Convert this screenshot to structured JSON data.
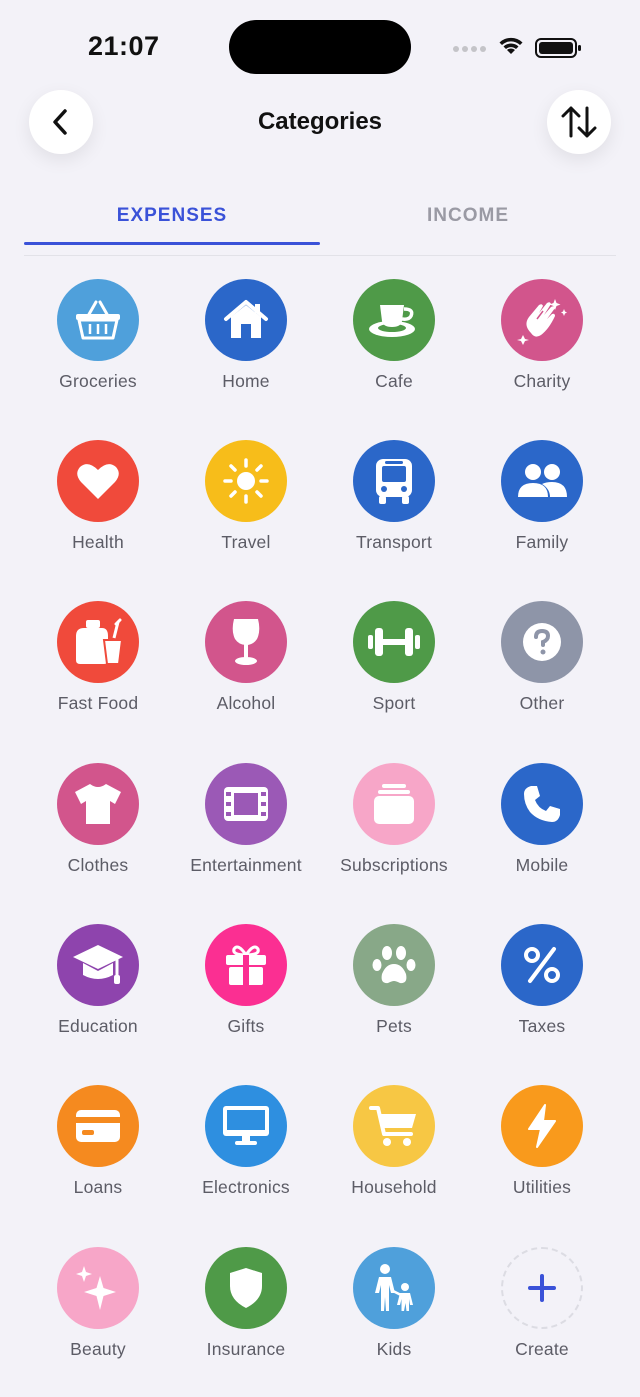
{
  "status_bar": {
    "time": "21:07"
  },
  "header": {
    "title": "Categories",
    "back_icon": "chevron-left-icon",
    "sort_icon": "arrows-up-down-icon"
  },
  "tabs": [
    {
      "label": "EXPENSES",
      "selected": true
    },
    {
      "label": "INCOME",
      "selected": false
    }
  ],
  "colors": {
    "accent": "#3a52d8"
  },
  "categories": [
    {
      "label": "Groceries",
      "icon": "basket-icon",
      "color": "#4fa0db"
    },
    {
      "label": "Home",
      "icon": "house-icon",
      "color": "#2b67c9"
    },
    {
      "label": "Cafe",
      "icon": "coffee-cup-icon",
      "color": "#4f9a48"
    },
    {
      "label": "Charity",
      "icon": "clapping-hands-icon",
      "color": "#d2558c"
    },
    {
      "label": "Health",
      "icon": "heart-icon",
      "color": "#f04a3b"
    },
    {
      "label": "Travel",
      "icon": "sun-icon",
      "color": "#f7bd1a"
    },
    {
      "label": "Transport",
      "icon": "bus-icon",
      "color": "#2b67c9"
    },
    {
      "label": "Family",
      "icon": "people-icon",
      "color": "#2b67c9"
    },
    {
      "label": "Fast Food",
      "icon": "fast-food-icon",
      "color": "#f04a3b"
    },
    {
      "label": "Alcohol",
      "icon": "wine-glass-icon",
      "color": "#d2558c"
    },
    {
      "label": "Sport",
      "icon": "dumbbell-icon",
      "color": "#4f9a48"
    },
    {
      "label": "Other",
      "icon": "question-icon",
      "color": "#8e95a8"
    },
    {
      "label": "Clothes",
      "icon": "tshirt-icon",
      "color": "#d2558c"
    },
    {
      "label": "Entertainment",
      "icon": "film-icon",
      "color": "#9b59b6"
    },
    {
      "label": "Subscriptions",
      "icon": "stack-icon",
      "color": "#f7a6c8"
    },
    {
      "label": "Mobile",
      "icon": "phone-icon",
      "color": "#2b67c9"
    },
    {
      "label": "Education",
      "icon": "graduation-cap-icon",
      "color": "#8e44ad"
    },
    {
      "label": "Gifts",
      "icon": "gift-icon",
      "color": "#fb2f92"
    },
    {
      "label": "Pets",
      "icon": "paw-icon",
      "color": "#88a888"
    },
    {
      "label": "Taxes",
      "icon": "percent-icon",
      "color": "#2b67c9"
    },
    {
      "label": "Loans",
      "icon": "credit-card-icon",
      "color": "#f58a1f"
    },
    {
      "label": "Electronics",
      "icon": "monitor-icon",
      "color": "#2e8fe0"
    },
    {
      "label": "Household",
      "icon": "cart-icon",
      "color": "#f7c744"
    },
    {
      "label": "Utilities",
      "icon": "lightning-icon",
      "color": "#f99a1c"
    },
    {
      "label": "Beauty",
      "icon": "sparkles-icon",
      "color": "#f7a6c8"
    },
    {
      "label": "Insurance",
      "icon": "shield-icon",
      "color": "#4f9a48"
    },
    {
      "label": "Kids",
      "icon": "parent-child-icon",
      "color": "#4fa0db"
    },
    {
      "label": "Create",
      "icon": "plus-icon",
      "color": "#3a52d8"
    }
  ]
}
